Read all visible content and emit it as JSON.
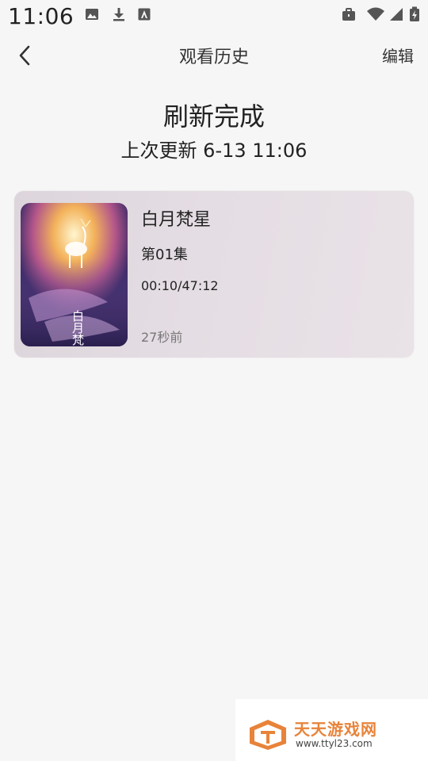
{
  "status_bar": {
    "time": "11:06",
    "left_icons": [
      "image-icon",
      "download-icon",
      "store-icon"
    ],
    "right_icons": [
      "briefcase-icon",
      "wifi-icon",
      "signal-icon",
      "battery-icon"
    ]
  },
  "header": {
    "back_icon": "chevron-left-icon",
    "title": "观看历史",
    "edit_label": "编辑"
  },
  "refresh": {
    "title": "刷新完成",
    "last_update": "上次更新 6-13 11:06"
  },
  "history": [
    {
      "title": "白月梵星",
      "episode": "第01集",
      "progress": "00:10/47:12",
      "time_ago": "27秒前",
      "poster_text": "白月梵星"
    }
  ],
  "watermark": {
    "name": "天天游戏网",
    "url": "www.ttyl23.com"
  },
  "colors": {
    "background": "#f7f6f7",
    "card": "#e4dde3",
    "watermark_orange": "#e8833a"
  }
}
